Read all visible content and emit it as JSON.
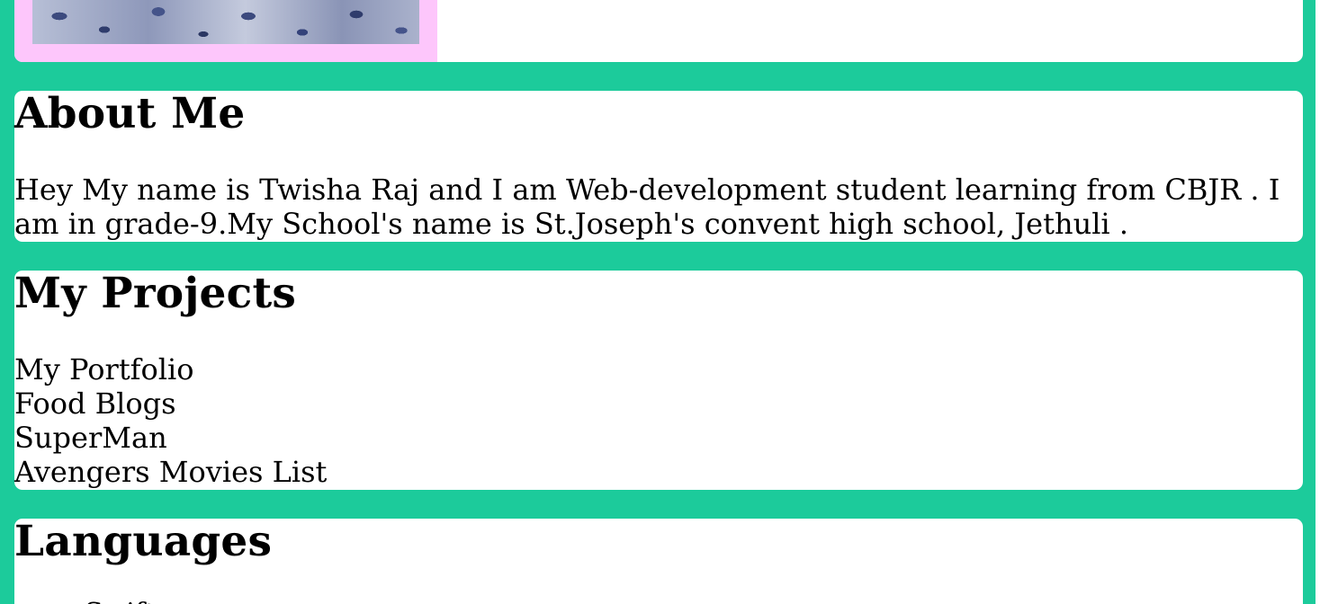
{
  "about": {
    "title": "About Me",
    "text": "Hey My name is Twisha Raj and I am Web-development student learning from CBJR . I am in grade-9.My School's name is St.Joseph's convent high school, Jethuli ."
  },
  "projects": {
    "title": "My Projects",
    "items": [
      "My Portfolio",
      "Food Blogs",
      "SuperMan",
      "Avengers Movies List"
    ]
  },
  "languages": {
    "title": "Languages",
    "items": [
      "Swift"
    ]
  },
  "colors": {
    "page_background": "#1ccb9b",
    "card_background": "#ffffff",
    "photo_frame": "#fdc6fb"
  }
}
